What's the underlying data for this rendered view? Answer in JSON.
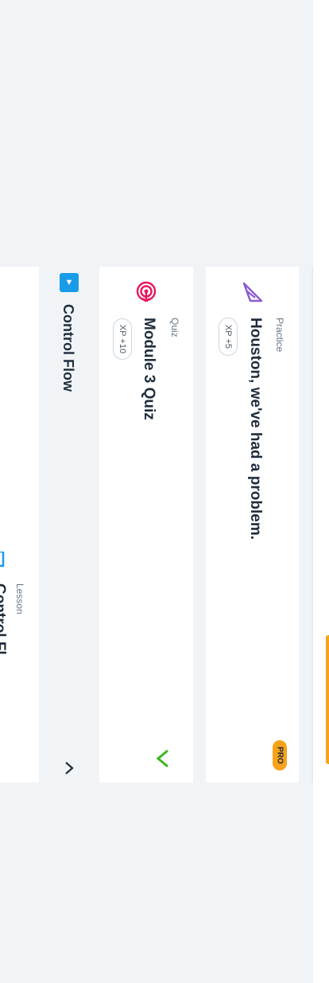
{
  "cards": {
    "lesson": {
      "type_label": "Lesson",
      "title": "Control Fl"
    },
    "quiz": {
      "type_label": "Quiz",
      "title": "Module 3 Quiz",
      "xp": "XP +10",
      "icon": "target-icon",
      "status_icon": "check-icon"
    },
    "practice": {
      "type_label": "Practice",
      "title": "Houston, we've had a problem.",
      "xp": "XP +5",
      "badge": "PRO",
      "icon": "rocket-icon"
    }
  },
  "section": {
    "title": "Control Flow",
    "toggle_glyph": "▼",
    "expand_icon": "chevron-right-icon"
  },
  "colors": {
    "background": "#f1f4f7",
    "card": "#ffffff",
    "accent_blue": "#1a9be8",
    "quiz_icon": "#e8175d",
    "practice_icon": "#8a5cd6",
    "success": "#3cb521",
    "pro_badge": "#f6a21a"
  }
}
